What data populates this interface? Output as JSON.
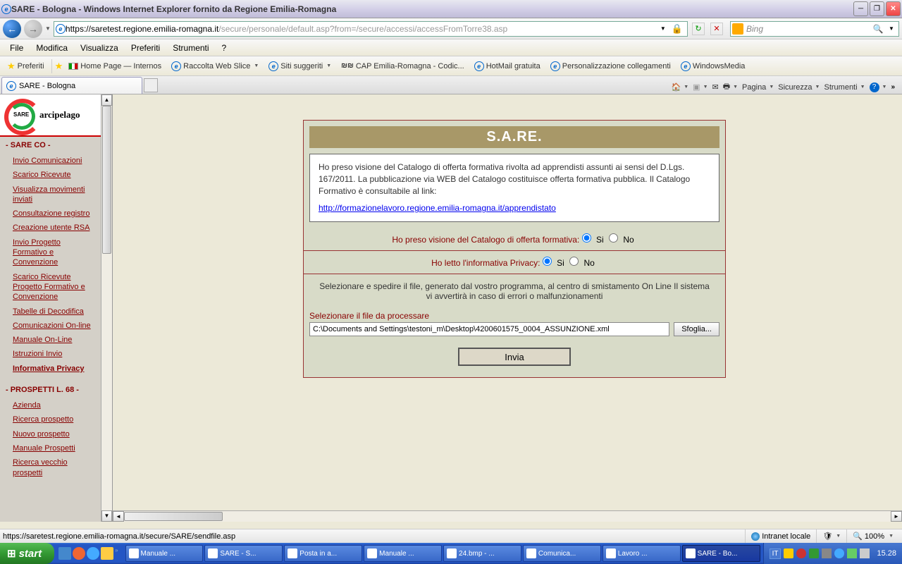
{
  "window": {
    "title": "SARE - Bologna - Windows Internet Explorer fornito da Regione Emilia-Romagna"
  },
  "address": {
    "host": "https://saretest.regione.emilia-romagna.it",
    "path": "/secure/personale/default.asp?from=/secure/accessi/accessFromTorre38.asp"
  },
  "search": {
    "placeholder": "Bing"
  },
  "menu": [
    "File",
    "Modifica",
    "Visualizza",
    "Preferiti",
    "Strumenti",
    "?"
  ],
  "favorites": {
    "label": "Preferiti",
    "items": [
      "Home Page — Internos",
      "Raccolta Web Slice",
      "Siti suggeriti",
      "CAP Emilia-Romagna - Codic...",
      "HotMail gratuita",
      "Personalizzazione collegamenti",
      "WindowsMedia"
    ]
  },
  "tab": {
    "title": "SARE - Bologna"
  },
  "toolbar": {
    "page": "Pagina",
    "security": "Sicurezza",
    "tools": "Strumenti"
  },
  "sidebar": {
    "logo_text": "arcipelago",
    "logo_badge": "SARE",
    "section1": "- SARE CO -",
    "links1": [
      "Invio Comunicazioni",
      "Scarico Ricevute",
      "Visualizza movimenti inviati",
      "Consultazione registro",
      "Creazione utente RSA",
      "Invio Progetto Formativo e Convenzione",
      "Scarico Ricevute Progetto Formativo e Convenzione",
      "Tabelle di Decodifica",
      "Comunicazioni On-line",
      "Manuale On-Line",
      "Istruzioni Invio",
      "Informativa Privacy"
    ],
    "section2": "- PROSPETTI L. 68 -",
    "links2": [
      "Azienda",
      "Ricerca prospetto",
      "Nuovo prospetto",
      "Manuale Prospetti",
      "Ricerca vecchio prospetti"
    ]
  },
  "form": {
    "title": "S.A.RE.",
    "info_text": "Ho preso visione del Catalogo di offerta formativa rivolta ad apprendisti assunti ai sensi del D.Lgs. 167/2011. La pubblicazione via WEB del Catalogo costituisce offerta formativa pubblica. Il Catalogo Formativo è consultabile al link:",
    "info_link": "http://formazionelavoro.regione.emilia-romagna.it/apprendistato",
    "catalog_q": "Ho preso visione del Catalogo di offerta formativa:",
    "privacy_q": "Ho letto l'informativa Privacy:",
    "yes": "Si",
    "no": "No",
    "instruction": "Selezionare e spedire il file, generato dal vostro programma, al centro di smistamento On Line Il sistema vi avvertirà in caso di errori o malfunzionamenti",
    "file_label": "Selezionare il file da processare",
    "file_value": "C:\\Documents and Settings\\testoni_m\\Desktop\\4200601575_0004_ASSUNZIONE.xml",
    "browse": "Sfoglia...",
    "submit": "Invia"
  },
  "status": {
    "text": "https://saretest.regione.emilia-romagna.it/secure/SARE/sendfile.asp",
    "zone": "Intranet locale",
    "zoom": "100%"
  },
  "taskbar": {
    "start": "start",
    "items": [
      "Manuale ...",
      "SARE - S...",
      "Posta in a...",
      "Manuale ...",
      "24.bmp - ...",
      "Comunica...",
      "Lavoro ...",
      "SARE - Bo..."
    ],
    "lang": "IT",
    "time": "15.28"
  }
}
